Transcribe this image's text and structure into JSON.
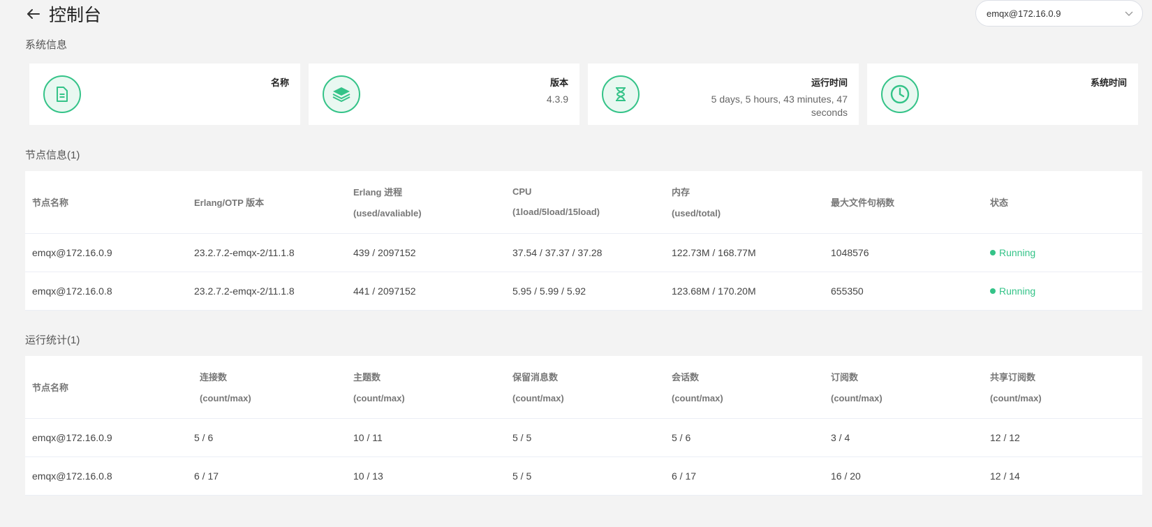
{
  "header": {
    "title": "控制台",
    "node_select_value": "emqx@172.16.0.9"
  },
  "system_info": {
    "section_title": "系统信息",
    "cards": [
      {
        "label": "名称",
        "value": "",
        "icon": "document-icon"
      },
      {
        "label": "版本",
        "value": "4.3.9",
        "icon": "layers-icon"
      },
      {
        "label": "运行时间",
        "value": "5 days, 5 hours, 43 minutes, 47 seconds",
        "icon": "hourglass-icon"
      },
      {
        "label": "系统时间",
        "value": "",
        "icon": "clock-icon"
      }
    ]
  },
  "nodes": {
    "section_title": "节点信息(1)",
    "headers": [
      {
        "main": "节点名称",
        "sub": ""
      },
      {
        "main": "Erlang/OTP 版本",
        "sub": ""
      },
      {
        "main": "Erlang 进程",
        "sub": "(used/avaliable)"
      },
      {
        "main": "CPU",
        "sub": "(1load/5load/15load)"
      },
      {
        "main": "内存",
        "sub": "(used/total)"
      },
      {
        "main": "最大文件句柄数",
        "sub": ""
      },
      {
        "main": "状态",
        "sub": ""
      }
    ],
    "rows": [
      [
        "emqx@172.16.0.9",
        "23.2.7.2-emqx-2/11.1.8",
        "439 / 2097152",
        "37.54 / 37.37 / 37.28",
        "122.73M / 168.77M",
        "1048576",
        "Running"
      ],
      [
        "emqx@172.16.0.8",
        "23.2.7.2-emqx-2/11.1.8",
        "441 / 2097152",
        "5.95 / 5.99 / 5.92",
        "123.68M / 170.20M",
        "655350",
        "Running"
      ]
    ]
  },
  "stats": {
    "section_title": "运行统计(1)",
    "headers": [
      {
        "main": "节点名称",
        "sub": ""
      },
      {
        "main": "连接数",
        "sub": "(count/max)"
      },
      {
        "main": "主题数",
        "sub": "(count/max)"
      },
      {
        "main": "保留消息数",
        "sub": "(count/max)"
      },
      {
        "main": "会话数",
        "sub": "(count/max)"
      },
      {
        "main": "订阅数",
        "sub": "(count/max)"
      },
      {
        "main": "共享订阅数",
        "sub": "(count/max)"
      }
    ],
    "rows": [
      [
        "emqx@172.16.0.9",
        "5 / 6",
        "10 / 11",
        "5 / 5",
        "5 / 6",
        "3 / 4",
        "12 / 12"
      ],
      [
        "emqx@172.16.0.8",
        "6 / 17",
        "10 / 13",
        "5 / 5",
        "6 / 17",
        "16 / 20",
        "12 / 14"
      ]
    ]
  },
  "colors": {
    "accent": "#34c388",
    "background": "#f3f3f3"
  }
}
